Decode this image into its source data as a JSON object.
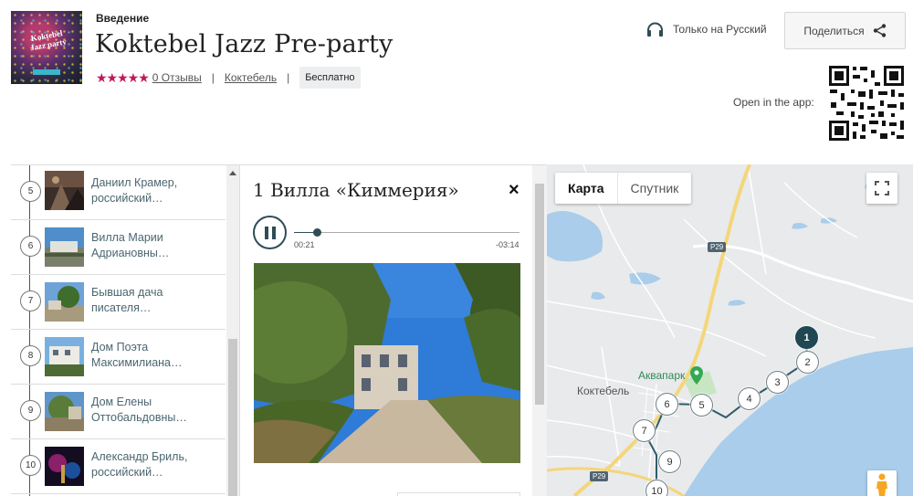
{
  "header": {
    "section_label": "Введение",
    "title": "Koktebel Jazz Pre-party",
    "cover_text": "Koktebel Jazz party",
    "rating_stars": "★★★★★",
    "reviews_link": "0 Отзывы",
    "location_link": "Коктебель",
    "separator": "|",
    "price_tag": "Бесплатно",
    "language": "Только на Русский",
    "share_button": "Поделиться",
    "open_in_app": "Open in the app:"
  },
  "stops": [
    {
      "number": "5",
      "title": "Даниил Крамер, российский…"
    },
    {
      "number": "6",
      "title": "Вилла Марии Адриановны…"
    },
    {
      "number": "7",
      "title": "Бывшая дача писателя…"
    },
    {
      "number": "8",
      "title": "Дом Поэта Максимилиана…"
    },
    {
      "number": "9",
      "title": "Дом Елены Оттобальдовны…"
    },
    {
      "number": "10",
      "title": "Александр Бриль, российский…"
    }
  ],
  "player": {
    "stop_title": "1 Вилла «Киммерия»",
    "close": "×",
    "current_time": "00:21",
    "remaining_time": "-03:14",
    "progress": 0.1
  },
  "map": {
    "tab_map": "Карта",
    "tab_satellite": "Спутник",
    "town_label": "Коктебель",
    "poi_label": "Аквапарк",
    "road_badge_1": "P29",
    "road_badge_2": "P29",
    "pins": [
      {
        "n": "1",
        "active": true
      },
      {
        "n": "2"
      },
      {
        "n": "3"
      },
      {
        "n": "4"
      },
      {
        "n": "5"
      },
      {
        "n": "6"
      },
      {
        "n": "7"
      },
      {
        "n": "9"
      },
      {
        "n": "10"
      }
    ]
  },
  "colors": {
    "star": "#c2185b",
    "accent": "#2f4c56",
    "link": "#4a6670",
    "sea": "#a9cdea"
  }
}
